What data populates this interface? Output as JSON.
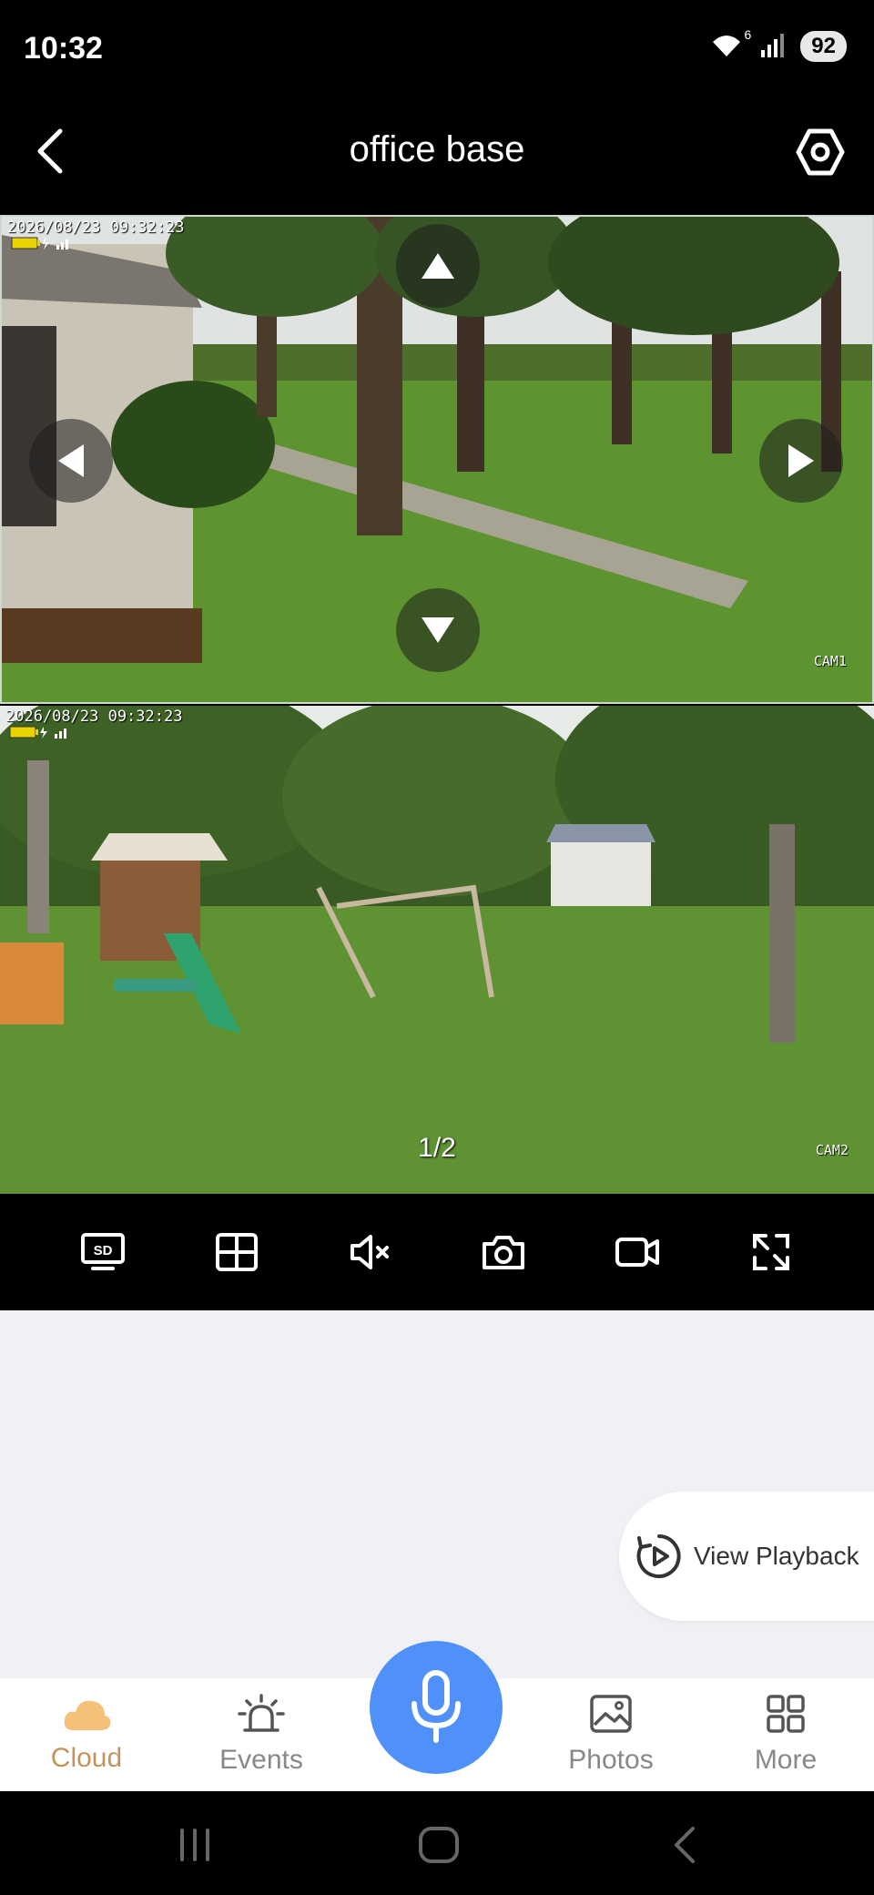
{
  "status_bar": {
    "time": "10:32",
    "wifi_badge": "6",
    "battery": "92"
  },
  "header": {
    "title": "office base"
  },
  "cameras": [
    {
      "timestamp": "2026/08/23 09:32:23",
      "label": "CAM1"
    },
    {
      "timestamp": "2026/08/23 09:32:23",
      "label": "CAM2"
    }
  ],
  "page_indicator": "1/2",
  "toolbar": {
    "sd_label": "SD"
  },
  "playback": {
    "label": "View Playback"
  },
  "bottom_nav": {
    "cloud": "Cloud",
    "events": "Events",
    "photos": "Photos",
    "more": "More"
  },
  "colors": {
    "accent": "#4f91f8",
    "cloud_active": "#c2935c",
    "background": "#f1f1f5"
  }
}
